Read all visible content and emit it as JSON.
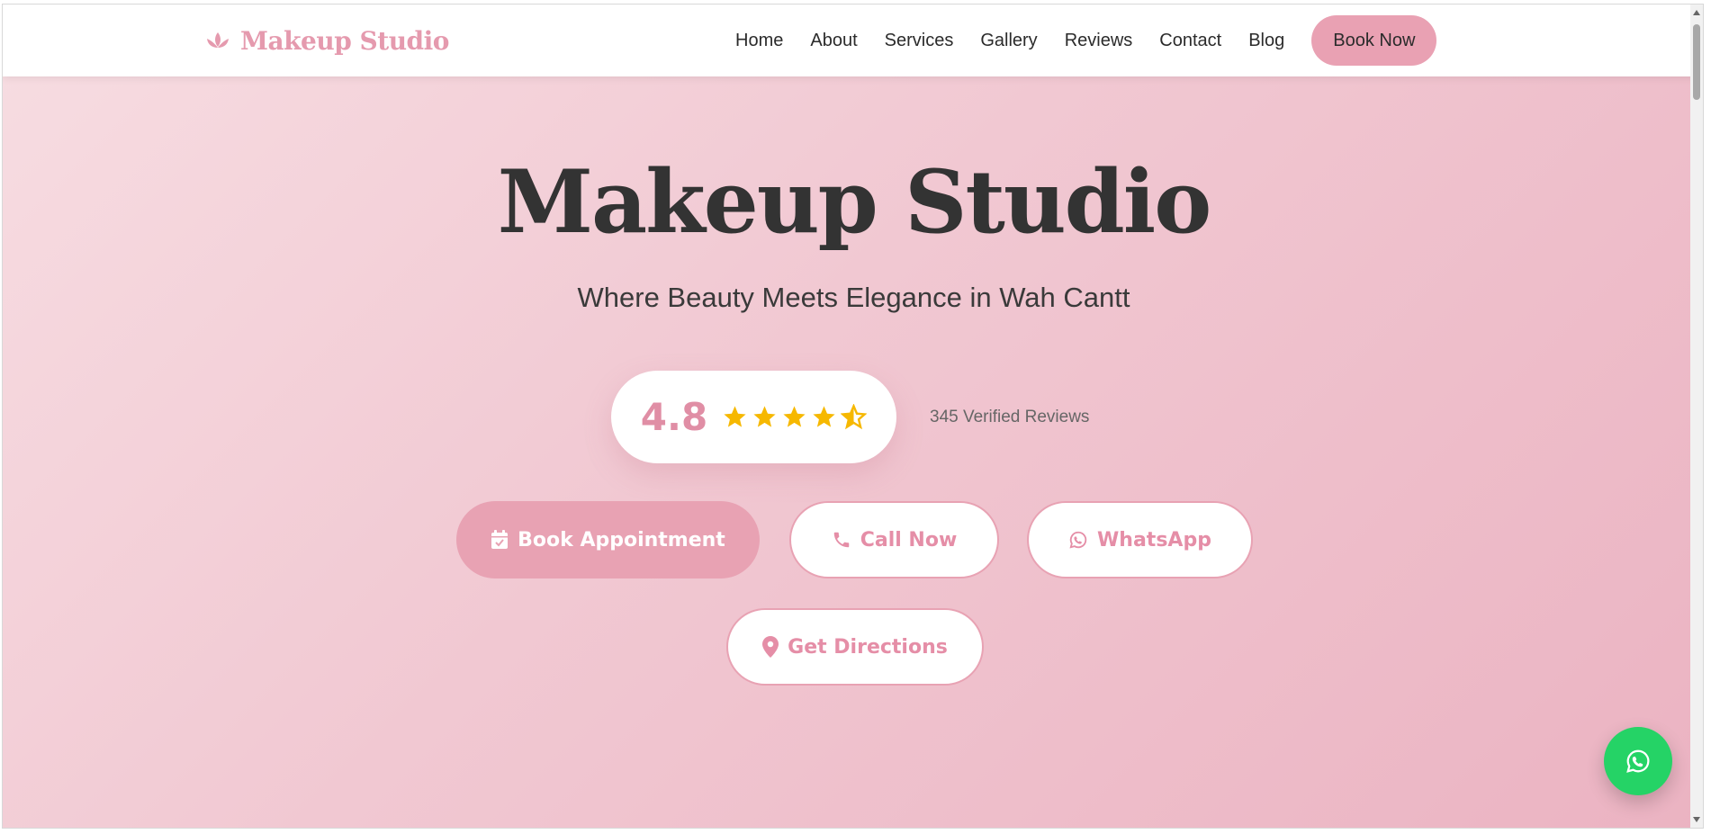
{
  "header": {
    "logo_text": "Makeup Studio",
    "logo_icon": "lotus-icon",
    "nav": [
      {
        "label": "Home"
      },
      {
        "label": "About"
      },
      {
        "label": "Services"
      },
      {
        "label": "Gallery"
      },
      {
        "label": "Reviews"
      },
      {
        "label": "Contact"
      },
      {
        "label": "Blog"
      }
    ],
    "cta_label": "Book Now"
  },
  "hero": {
    "title": "Makeup Studio",
    "subtitle": "Where Beauty Meets Elegance in Wah Cantt",
    "rating": {
      "value": "4.8",
      "stars_out_of": 5,
      "stars_filled": 4.5,
      "reviews_text": "345 Verified Reviews"
    },
    "buttons": {
      "book": {
        "label": "Book Appointment",
        "icon": "calendar-check-icon"
      },
      "call": {
        "label": "Call Now",
        "icon": "phone-icon"
      },
      "whatsapp": {
        "label": "WhatsApp",
        "icon": "whatsapp-icon"
      },
      "directions": {
        "label": "Get Directions",
        "icon": "map-pin-icon"
      }
    }
  },
  "floating_action": {
    "icon": "whatsapp-icon"
  },
  "colors": {
    "accent": "#e8a2b3",
    "accent_text": "#e58ea7",
    "star": "#f6b800",
    "whatsapp": "#25d366",
    "title": "#333333"
  }
}
